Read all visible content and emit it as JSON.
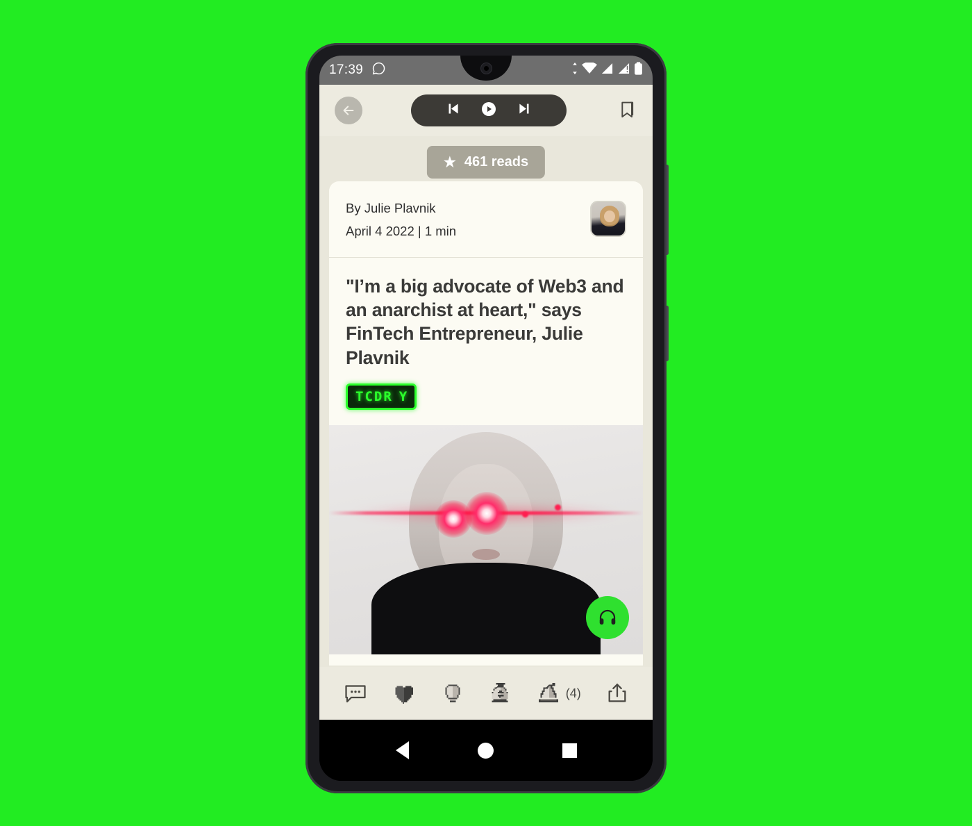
{
  "device": {
    "status_bar": {
      "time": "17:39",
      "icons": [
        "whatsapp-icon",
        "data-transfer-icon",
        "wifi-icon",
        "signal-icon",
        "signal-alert-icon",
        "battery-icon"
      ]
    },
    "nav_bar": {
      "back": "back-triangle",
      "home": "home-circle",
      "recents": "recents-square"
    }
  },
  "app": {
    "topbar": {
      "back_label": "back-arrow",
      "player": {
        "previous_label": "previous-track",
        "play_label": "play",
        "next_label": "next-track"
      },
      "bookmark_label": "bookmark"
    },
    "reads_badge": {
      "star": "★",
      "text": "461 reads"
    },
    "article": {
      "author": "By Julie Plavnik",
      "date_read": "April 4 2022  |  1 min",
      "headline": "\"I’m a big advocate of Web3 and an anarchist at heart,\" says FinTech Entrepreneur, Julie Plavnik",
      "logo": {
        "text": "TCDR",
        "mark": "Y"
      },
      "hero_alt": "portrait of blonde woman with red laser eyes"
    },
    "fab": {
      "label": "listen-headphones"
    },
    "toolbar": {
      "items": [
        {
          "name": "comment",
          "icon": "comment-bubble-icon",
          "count": ""
        },
        {
          "name": "heart",
          "icon": "heart-icon",
          "count": ""
        },
        {
          "name": "idea",
          "icon": "lightbulb-icon",
          "count": ""
        },
        {
          "name": "money",
          "icon": "money-bag-icon",
          "count": ""
        },
        {
          "name": "party",
          "icon": "party-hat-icon",
          "count": "(4)"
        },
        {
          "name": "share",
          "icon": "share-icon",
          "count": ""
        }
      ]
    }
  },
  "colors": {
    "background": "#22ec22",
    "accent_green": "#2fe02f",
    "page": "#e9e7db",
    "card": "#fcfbf3",
    "badge": "#a8a598"
  }
}
